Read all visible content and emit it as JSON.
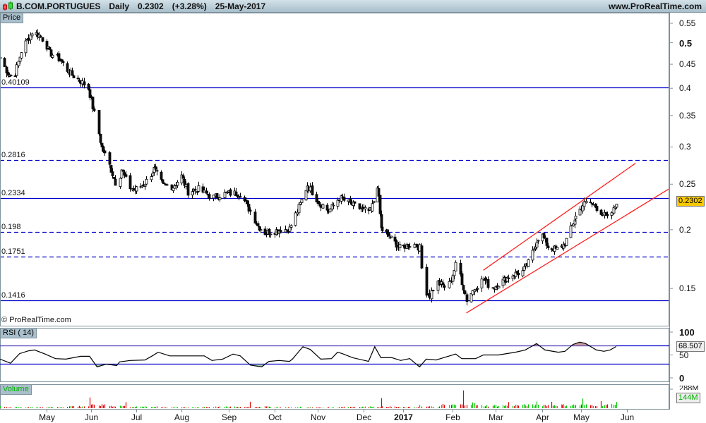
{
  "header": {
    "symbol": "B.COM.PORTUGUES",
    "period": "Daily",
    "last_price": "0.2302",
    "change": "(+3.28%)",
    "date": "25-May-2017",
    "website": "www.ProRealTime.com",
    "icon": "candlestick-icon"
  },
  "panels": {
    "price_label": "Price",
    "rsi_label": "RSI ( 14)",
    "volume_label": "Volume",
    "copyright": "© ProRealTime.com",
    "last_price_tag": "0.2302",
    "rsi_tag": "68.507",
    "volume_tag": "144M",
    "volume_top_tick": "288M"
  },
  "colors": {
    "header_bg": "#b8ccd6",
    "level_line": "#0000cc",
    "channel_line": "#ff2020",
    "price_tag_bg": "#f8c800",
    "volume_up": "#00cc00",
    "volume_down": "#dd0000",
    "rsi_overbought_fill": "#c89a9a",
    "rsi_oversold_fill": "#a8cca0"
  },
  "chart_data": [
    {
      "type": "candlestick",
      "scale": "log",
      "ylim": [
        0.125,
        0.56
      ],
      "y_ticks": [
        {
          "label": "0.55",
          "value": 0.55,
          "bold": false
        },
        {
          "label": "0.5",
          "value": 0.5,
          "bold": true
        },
        {
          "label": "0.45",
          "value": 0.45,
          "bold": false
        },
        {
          "label": "0.4",
          "value": 0.4,
          "bold": false
        },
        {
          "label": "0.35",
          "value": 0.35,
          "bold": false
        },
        {
          "label": "0.3",
          "value": 0.3,
          "bold": false
        },
        {
          "label": "0.25",
          "value": 0.25,
          "bold": false
        },
        {
          "label": "0.2",
          "value": 0.2,
          "bold": false
        },
        {
          "label": "0.15",
          "value": 0.15,
          "bold": false
        }
      ],
      "x_ticks": [
        {
          "label": "May",
          "date": "2016-05-02",
          "bold": false
        },
        {
          "label": "Jun",
          "date": "2016-06-01",
          "bold": false
        },
        {
          "label": "Jul",
          "date": "2016-07-01",
          "bold": false
        },
        {
          "label": "Aug",
          "date": "2016-08-01",
          "bold": false
        },
        {
          "label": "Sep",
          "date": "2016-09-01",
          "bold": false
        },
        {
          "label": "Oct",
          "date": "2016-10-03",
          "bold": false
        },
        {
          "label": "Nov",
          "date": "2016-11-01",
          "bold": false
        },
        {
          "label": "Dec",
          "date": "2016-12-01",
          "bold": false
        },
        {
          "label": "2017",
          "date": "2017-01-02",
          "bold": true
        },
        {
          "label": "Feb",
          "date": "2017-02-01",
          "bold": false
        },
        {
          "label": "Mar",
          "date": "2017-03-01",
          "bold": false
        },
        {
          "label": "Apr",
          "date": "2017-04-03",
          "bold": false
        },
        {
          "label": "May",
          "date": "2017-05-02",
          "bold": false
        },
        {
          "label": "Jun",
          "date": "2017-06-01",
          "bold": false
        }
      ],
      "levels": [
        {
          "label": "0.40109",
          "value": 0.40109,
          "style": "solid"
        },
        {
          "label": "0.2816",
          "value": 0.2816,
          "style": "dashed"
        },
        {
          "label": "0.2334",
          "value": 0.2334,
          "style": "solid"
        },
        {
          "label": "0.198",
          "value": 0.198,
          "style": "dashed"
        },
        {
          "label": "0.1751",
          "value": 0.1751,
          "style": "dashed"
        },
        {
          "label": "0.1416",
          "value": 0.1416,
          "style": "solid"
        }
      ],
      "trendlines": [
        {
          "from": {
            "date": "2017-02-21",
            "price": 0.164
          },
          "to": {
            "date": "2017-06-07",
            "price": 0.277
          }
        },
        {
          "from": {
            "date": "2017-02-10",
            "price": 0.133
          },
          "to": {
            "date": "2017-06-30",
            "price": 0.244
          }
        }
      ],
      "close_series": [
        [
          "2016-04-01",
          0.465
        ],
        [
          "2016-04-06",
          0.43
        ],
        [
          "2016-04-10",
          0.42
        ],
        [
          "2016-04-15",
          0.48
        ],
        [
          "2016-04-22",
          0.527
        ],
        [
          "2016-04-27",
          0.519
        ],
        [
          "2016-05-01",
          0.5
        ],
        [
          "2016-05-04",
          0.476
        ],
        [
          "2016-05-11",
          0.46
        ],
        [
          "2016-05-18",
          0.429
        ],
        [
          "2016-05-25",
          0.414
        ],
        [
          "2016-05-30",
          0.4
        ],
        [
          "2016-06-04",
          0.343
        ],
        [
          "2016-06-08",
          0.299
        ],
        [
          "2016-06-13",
          0.274
        ],
        [
          "2016-06-18",
          0.247
        ],
        [
          "2016-06-21",
          0.269
        ],
        [
          "2016-06-26",
          0.247
        ],
        [
          "2016-06-30",
          0.243
        ],
        [
          "2016-07-07",
          0.251
        ],
        [
          "2016-07-13",
          0.269
        ],
        [
          "2016-07-19",
          0.249
        ],
        [
          "2016-07-26",
          0.247
        ],
        [
          "2016-08-01",
          0.26
        ],
        [
          "2016-08-05",
          0.241
        ],
        [
          "2016-08-12",
          0.244
        ],
        [
          "2016-08-21",
          0.234
        ],
        [
          "2016-08-30",
          0.239
        ],
        [
          "2016-09-09",
          0.239
        ],
        [
          "2016-09-16",
          0.219
        ],
        [
          "2016-09-21",
          0.204
        ],
        [
          "2016-09-26",
          0.197
        ],
        [
          "2016-10-03",
          0.199
        ],
        [
          "2016-10-13",
          0.201
        ],
        [
          "2016-10-20",
          0.227
        ],
        [
          "2016-10-25",
          0.249
        ],
        [
          "2016-11-01",
          0.23
        ],
        [
          "2016-11-08",
          0.219
        ],
        [
          "2016-11-15",
          0.234
        ],
        [
          "2016-11-22",
          0.227
        ],
        [
          "2016-12-01",
          0.22
        ],
        [
          "2016-12-07",
          0.219
        ],
        [
          "2016-12-12",
          0.249
        ],
        [
          "2016-12-15",
          0.201
        ],
        [
          "2016-12-24",
          0.19
        ],
        [
          "2016-12-30",
          0.183
        ],
        [
          "2017-01-08",
          0.187
        ],
        [
          "2017-01-12",
          0.183
        ],
        [
          "2017-01-14",
          0.15
        ],
        [
          "2017-01-18",
          0.145
        ],
        [
          "2017-01-22",
          0.155
        ],
        [
          "2017-01-29",
          0.15
        ],
        [
          "2017-02-04",
          0.172
        ],
        [
          "2017-02-07",
          0.155
        ],
        [
          "2017-02-10",
          0.142
        ],
        [
          "2017-02-15",
          0.15
        ],
        [
          "2017-02-21",
          0.157
        ],
        [
          "2017-02-26",
          0.15
        ],
        [
          "2017-03-05",
          0.155
        ],
        [
          "2017-03-12",
          0.16
        ],
        [
          "2017-03-20",
          0.163
        ],
        [
          "2017-03-25",
          0.172
        ],
        [
          "2017-03-30",
          0.19
        ],
        [
          "2017-04-02",
          0.197
        ],
        [
          "2017-04-07",
          0.184
        ],
        [
          "2017-04-15",
          0.181
        ],
        [
          "2017-04-20",
          0.187
        ],
        [
          "2017-04-27",
          0.211
        ],
        [
          "2017-05-03",
          0.226
        ],
        [
          "2017-05-07",
          0.23
        ],
        [
          "2017-05-14",
          0.22
        ],
        [
          "2017-05-19",
          0.211
        ],
        [
          "2017-05-23",
          0.22
        ],
        [
          "2017-05-25",
          0.2302
        ]
      ]
    },
    {
      "type": "line",
      "name": "RSI ( 14)",
      "ylim": [
        0,
        100
      ],
      "y_ticks": [
        {
          "label": "100",
          "value": 100,
          "bold": true
        },
        {
          "label": "50",
          "value": 50,
          "bold": false
        },
        {
          "label": "0",
          "value": 0,
          "bold": true
        }
      ],
      "bands": [
        70,
        30
      ],
      "series": [
        [
          "2016-04-01",
          41
        ],
        [
          "2016-04-08",
          32
        ],
        [
          "2016-04-14",
          53
        ],
        [
          "2016-04-20",
          59
        ],
        [
          "2016-04-24",
          61
        ],
        [
          "2016-05-01",
          52
        ],
        [
          "2016-05-08",
          42
        ],
        [
          "2016-05-15",
          41
        ],
        [
          "2016-05-25",
          47
        ],
        [
          "2016-05-31",
          47
        ],
        [
          "2016-06-05",
          24
        ],
        [
          "2016-06-11",
          30
        ],
        [
          "2016-06-18",
          27
        ],
        [
          "2016-06-20",
          35
        ],
        [
          "2016-06-27",
          38
        ],
        [
          "2016-07-07",
          39
        ],
        [
          "2016-07-12",
          48
        ],
        [
          "2016-07-16",
          56
        ],
        [
          "2016-07-24",
          48
        ],
        [
          "2016-07-31",
          48
        ],
        [
          "2016-08-09",
          48
        ],
        [
          "2016-08-16",
          48
        ],
        [
          "2016-08-21",
          38
        ],
        [
          "2016-08-28",
          41
        ],
        [
          "2016-09-04",
          52
        ],
        [
          "2016-09-09",
          48
        ],
        [
          "2016-09-16",
          28
        ],
        [
          "2016-09-24",
          24
        ],
        [
          "2016-09-29",
          36
        ],
        [
          "2016-10-06",
          38
        ],
        [
          "2016-10-13",
          36
        ],
        [
          "2016-10-15",
          41
        ],
        [
          "2016-10-22",
          68
        ],
        [
          "2016-10-27",
          62
        ],
        [
          "2016-11-03",
          41
        ],
        [
          "2016-11-10",
          42
        ],
        [
          "2016-11-14",
          56
        ],
        [
          "2016-11-17",
          53
        ],
        [
          "2016-11-24",
          44
        ],
        [
          "2016-12-05",
          36
        ],
        [
          "2016-12-10",
          68
        ],
        [
          "2016-12-15",
          44
        ],
        [
          "2016-12-24",
          44
        ],
        [
          "2016-12-31",
          38
        ],
        [
          "2017-01-06",
          42
        ],
        [
          "2017-01-12",
          24
        ],
        [
          "2017-01-16",
          41
        ],
        [
          "2017-01-22",
          39
        ],
        [
          "2017-02-03",
          52
        ],
        [
          "2017-02-07",
          42
        ],
        [
          "2017-02-16",
          42
        ],
        [
          "2017-02-21",
          50
        ],
        [
          "2017-03-03",
          50
        ],
        [
          "2017-03-15",
          56
        ],
        [
          "2017-03-22",
          61
        ],
        [
          "2017-03-30",
          75
        ],
        [
          "2017-04-05",
          61
        ],
        [
          "2017-04-15",
          56
        ],
        [
          "2017-04-20",
          58
        ],
        [
          "2017-04-26",
          73
        ],
        [
          "2017-05-01",
          78
        ],
        [
          "2017-05-05",
          75
        ],
        [
          "2017-05-12",
          61
        ],
        [
          "2017-05-17",
          58
        ],
        [
          "2017-05-21",
          61
        ],
        [
          "2017-05-25",
          68.507
        ]
      ]
    },
    {
      "type": "bar",
      "name": "Volume",
      "unit": "M",
      "ylim": [
        0,
        330
      ],
      "series": [
        [
          "2016-04-01",
          25
        ],
        [
          "2016-05-15",
          25
        ],
        [
          "2016-05-31",
          165
        ],
        [
          "2016-06-10",
          60
        ],
        [
          "2016-06-24",
          70
        ],
        [
          "2016-07-15",
          30
        ],
        [
          "2016-08-15",
          20
        ],
        [
          "2016-09-16",
          105
        ],
        [
          "2016-09-30",
          25
        ],
        [
          "2016-10-20",
          20
        ],
        [
          "2016-11-15",
          20
        ],
        [
          "2016-12-15",
          115
        ],
        [
          "2016-12-28",
          20
        ],
        [
          "2017-01-12",
          70
        ],
        [
          "2017-01-25",
          35
        ],
        [
          "2017-02-08",
          310
        ],
        [
          "2017-02-15",
          80
        ],
        [
          "2017-03-10",
          70
        ],
        [
          "2017-03-30",
          130
        ],
        [
          "2017-04-10",
          80
        ],
        [
          "2017-05-03",
          110
        ],
        [
          "2017-05-15",
          80
        ],
        [
          "2017-05-25",
          144
        ]
      ]
    }
  ]
}
